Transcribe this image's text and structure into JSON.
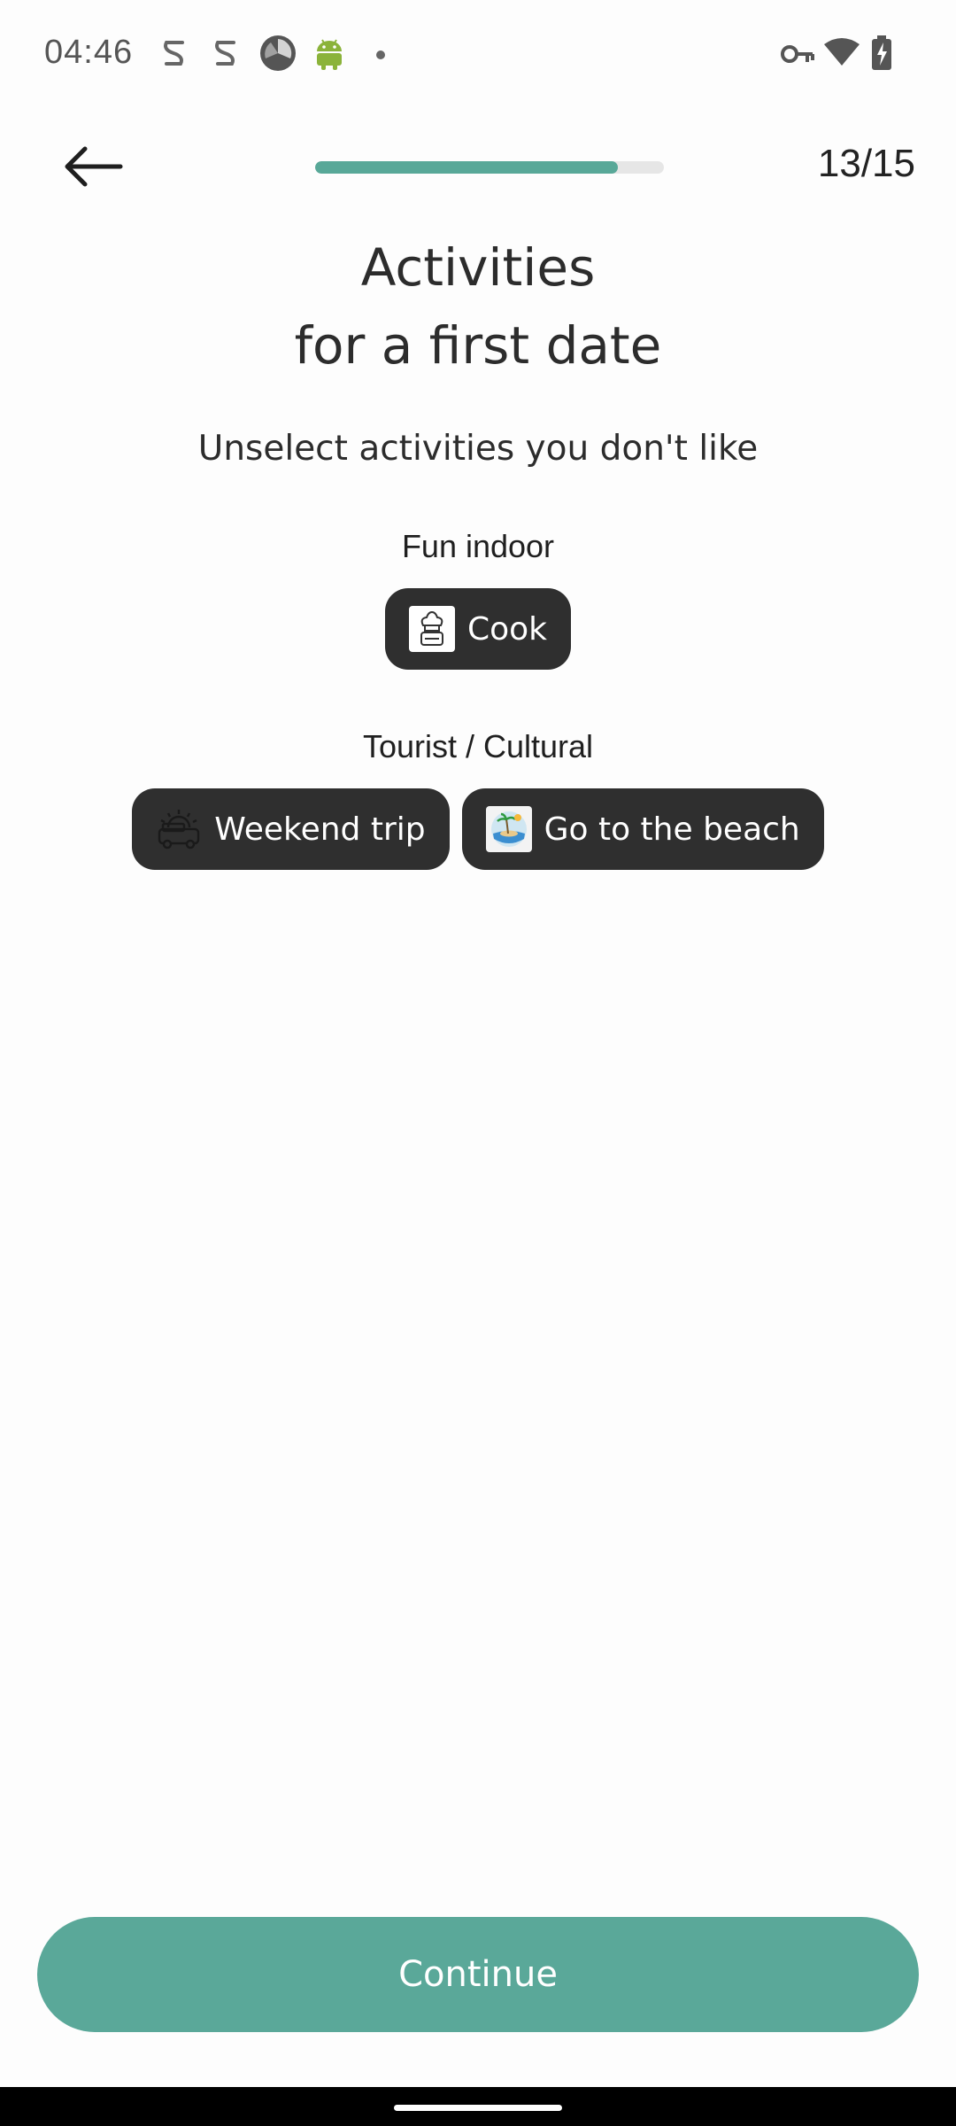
{
  "status_bar": {
    "time": "04:46",
    "left_icons": [
      "notification-s-icon",
      "notification-s-icon",
      "shutter-app-icon",
      "android-icon",
      "dot-icon"
    ],
    "right_icons": [
      "vpn-key-icon",
      "wifi-icon",
      "battery-charging-icon"
    ]
  },
  "header": {
    "back_icon": "arrow-left-icon",
    "progress_fraction": 0.867,
    "step_counter": "13/15"
  },
  "title": {
    "line1": "Activities",
    "line2": "for a first date"
  },
  "subtitle": "Unselect activities you don't like",
  "sections": [
    {
      "label": "Fun indoor",
      "chips": [
        {
          "label": "Cook",
          "icon": "chef-hat-icon"
        }
      ]
    },
    {
      "label": "Tourist / Cultural",
      "chips": [
        {
          "label": "Weekend trip",
          "icon": "car-sunrise-icon"
        },
        {
          "label": "Go to the beach",
          "icon": "beach-island-icon"
        }
      ]
    }
  ],
  "continue_label": "Continue",
  "colors": {
    "accent": "#5aa899",
    "chip_bg": "#2f2f2f",
    "text_dark": "#2c2c2c",
    "background": "#fdfdfd"
  }
}
